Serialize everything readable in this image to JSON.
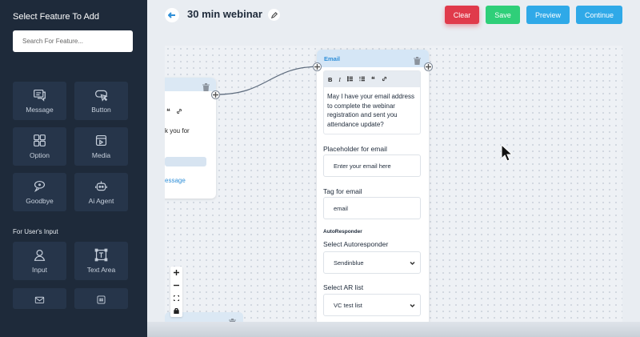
{
  "sidebar": {
    "title": "Select Feature To Add",
    "search_placeholder": "Search For Feature...",
    "tiles": [
      {
        "label": "Message",
        "icon": "message-icon"
      },
      {
        "label": "Button",
        "icon": "button-icon"
      },
      {
        "label": "Option",
        "icon": "option-grid-icon"
      },
      {
        "label": "Media",
        "icon": "media-icon"
      },
      {
        "label": "Goodbye",
        "icon": "goodbye-icon"
      },
      {
        "label": "Ai Agent",
        "icon": "ai-agent-icon"
      }
    ],
    "section_user_input": "For User's Input",
    "input_tiles": [
      {
        "label": "Input",
        "icon": "user-icon"
      },
      {
        "label": "Text Area",
        "icon": "text-area-icon"
      },
      {
        "label": "",
        "icon": "email-icon"
      },
      {
        "label": "",
        "icon": "number-icon"
      }
    ]
  },
  "header": {
    "title": "30 min webinar",
    "buttons": {
      "clear": "Clear",
      "save": "Save",
      "preview": "Preview",
      "continue": "Continue"
    }
  },
  "canvas": {
    "left_node": {
      "partial_text": "k you for",
      "partial_link": "essage",
      "toolbar_partial": "❝"
    },
    "email_node": {
      "title": "Email",
      "toolbar": [
        "B",
        "I",
        "list-ul",
        "list-ol",
        "quote",
        "link"
      ],
      "message": "May I have your email address to complete the webinar registration and sent you attendance update?",
      "placeholder_label": "Placeholder for email",
      "placeholder_value": "Enter your email here",
      "tag_label": "Tag for email",
      "tag_value": "email",
      "autoresponder_section": "AutoResponder",
      "select_autoresponder_label": "Select Autoresponder",
      "autoresponder_value": "Sendinblue",
      "select_ar_list_label": "Select AR list",
      "ar_list_value": "VC test list"
    }
  },
  "colors": {
    "sidebar_bg": "#1e2a3a",
    "clear": "#e03a4b",
    "save": "#2fcf79",
    "preview": "#2fa9e8",
    "continue": "#2fa9e8"
  }
}
